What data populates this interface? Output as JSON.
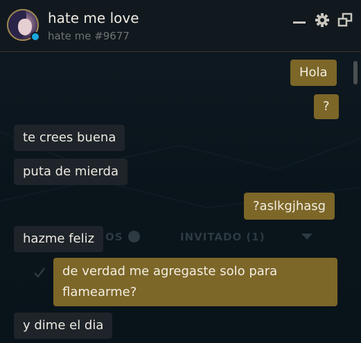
{
  "header": {
    "name": "hate me love",
    "tag": "hate me #9677"
  },
  "controls": {
    "minimize": "minimize-icon",
    "settings": "gear-icon",
    "popout": "popout-icon"
  },
  "background": {
    "ghost_os": "OS",
    "ghost_invitado": "INVITADO (1)"
  },
  "colors": {
    "outgoing_bubble": "#7c6628",
    "incoming_bubble": "#1e2429",
    "status_online": "#1ca6e0",
    "avatar_border": "#a08a52"
  },
  "messages": [
    {
      "direction": "out",
      "text": "Hola"
    },
    {
      "direction": "out",
      "text": "?"
    },
    {
      "direction": "in",
      "text": "te crees buena"
    },
    {
      "direction": "in",
      "text": "puta de mierda"
    },
    {
      "direction": "out",
      "text": "?aslkgjhasg"
    },
    {
      "direction": "in",
      "text": "hazme feliz"
    },
    {
      "direction": "out",
      "text": "de verdad me agregaste solo para flamearme?"
    },
    {
      "direction": "in",
      "text": "y dime el dia"
    }
  ]
}
